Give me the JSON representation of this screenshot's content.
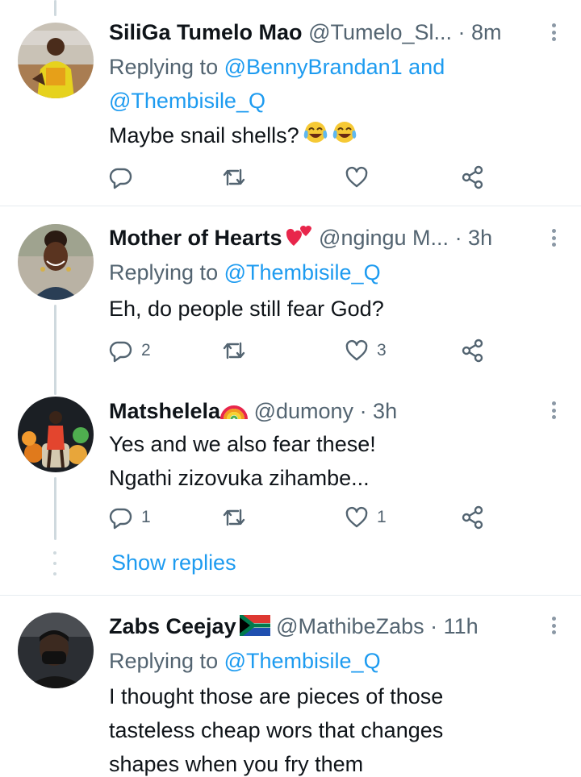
{
  "tweets": [
    {
      "name": "SiliGa Tumelo Mao",
      "handle": "@Tumelo_Sl...",
      "time": "· 8m",
      "reply_prefix": "Replying to ",
      "reply_mention_1": "@BennyBrandan1",
      "reply_and": " and",
      "reply_mention_2": "@Thembisile_Q",
      "text": "Maybe snail shells?",
      "emoji": "tears-of-joy-emoji",
      "actions": {
        "reply": "",
        "retweet": "",
        "like": ""
      }
    },
    {
      "name": "Mother of Hearts",
      "name_emoji": "two-hearts-emoji",
      "handle": "@ngingu M...",
      "time": "· 3h",
      "reply_prefix": "Replying to ",
      "reply_mention_1": "@Thembisile_Q",
      "text": "Eh, do people still fear God?",
      "actions": {
        "reply": "2",
        "retweet": "",
        "like": "3"
      }
    },
    {
      "name": "Matshelela",
      "name_emoji": "rainbow-emoji",
      "handle": "@dumony",
      "time": "· 3h",
      "text_line_1": "Yes and we also fear these!",
      "text_line_2": "Ngathi zizovuka zihambe...",
      "actions": {
        "reply": "1",
        "retweet": "",
        "like": "1"
      },
      "show_replies": "Show replies"
    },
    {
      "name": "Zabs Ceejay",
      "name_emoji": "south-africa-flag-emoji",
      "handle": "@MathibeZabs",
      "time": "· 11h",
      "reply_prefix": "Replying to ",
      "reply_mention_1": "@Thembisile_Q",
      "text_line_1": "I thought those are pieces of those",
      "text_line_2": "tasteless cheap wors that changes",
      "text_line_3": "shapes when you fry them"
    }
  ],
  "colors": {
    "accent": "#1d9bf0",
    "secondary_text": "#536471",
    "divider": "#e6ecf0"
  }
}
